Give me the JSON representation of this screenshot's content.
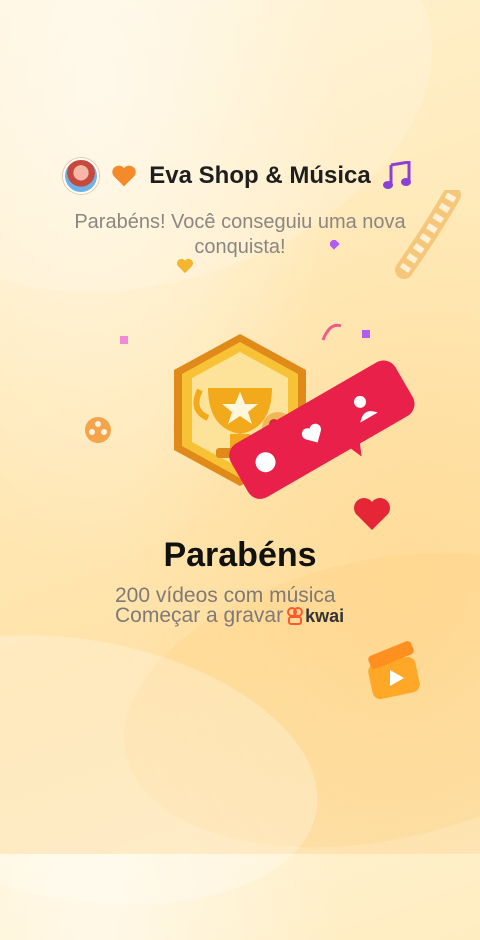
{
  "header": {
    "avatar_icon": "profile-avatar",
    "heart_icon": "orange-heart-emoji",
    "username": "Eva Shop & Música",
    "music_icon": "music-notes-emoji"
  },
  "message": {
    "subtitle": "Parabéns! Você conseguiu uma nova conquista!"
  },
  "achievement": {
    "badge_icon": "trophy-badge",
    "notification_icon": "like-comment-follow-card"
  },
  "main": {
    "title": "Parabéns",
    "line1": "200 vídeos com música",
    "line2": "Começar a gravar",
    "logo_text": "kwai"
  },
  "colors": {
    "background": "#ffe9b8",
    "card_red": "#e8204a",
    "badge_gold": "#f5b72a"
  }
}
